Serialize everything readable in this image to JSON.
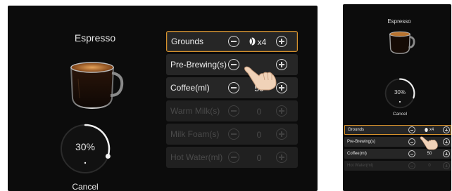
{
  "left_panel": {
    "title": "Espresso",
    "progress_text": "30%",
    "progress_fraction": 0.3,
    "cancel_label": "Cancel",
    "rows": [
      {
        "label": "Grounds",
        "value": "x4",
        "active": true,
        "disabled": false,
        "icon": "coffee-bean-icon"
      },
      {
        "label": "Pre-Brewing(s)",
        "value": "",
        "active": false,
        "disabled": false
      },
      {
        "label": "Coffee(ml)",
        "value": "50",
        "active": false,
        "disabled": false
      },
      {
        "label": "Warm Milk(s)",
        "value": "0",
        "active": false,
        "disabled": true
      },
      {
        "label": "Milk Foam(s)",
        "value": "0",
        "active": false,
        "disabled": true
      },
      {
        "label": "Hot Water(ml)",
        "value": "0",
        "active": false,
        "disabled": true
      }
    ]
  },
  "right_panel": {
    "title": "Espresso",
    "progress_text": "30%",
    "cancel_label": "Cancel",
    "rows": [
      {
        "label": "Grounds",
        "value": "x4",
        "active": true,
        "disabled": false
      },
      {
        "label": "Pre-Brewing(s)",
        "value": "",
        "active": false,
        "disabled": false
      },
      {
        "label": "Coffee(ml)",
        "value": "50",
        "active": false,
        "disabled": false
      },
      {
        "label": "Hot Water(ml)",
        "value": "0",
        "active": false,
        "disabled": true
      }
    ]
  },
  "colors": {
    "accent": "#d6922d",
    "background": "#0c0c0c",
    "row_bg": "#262626"
  }
}
